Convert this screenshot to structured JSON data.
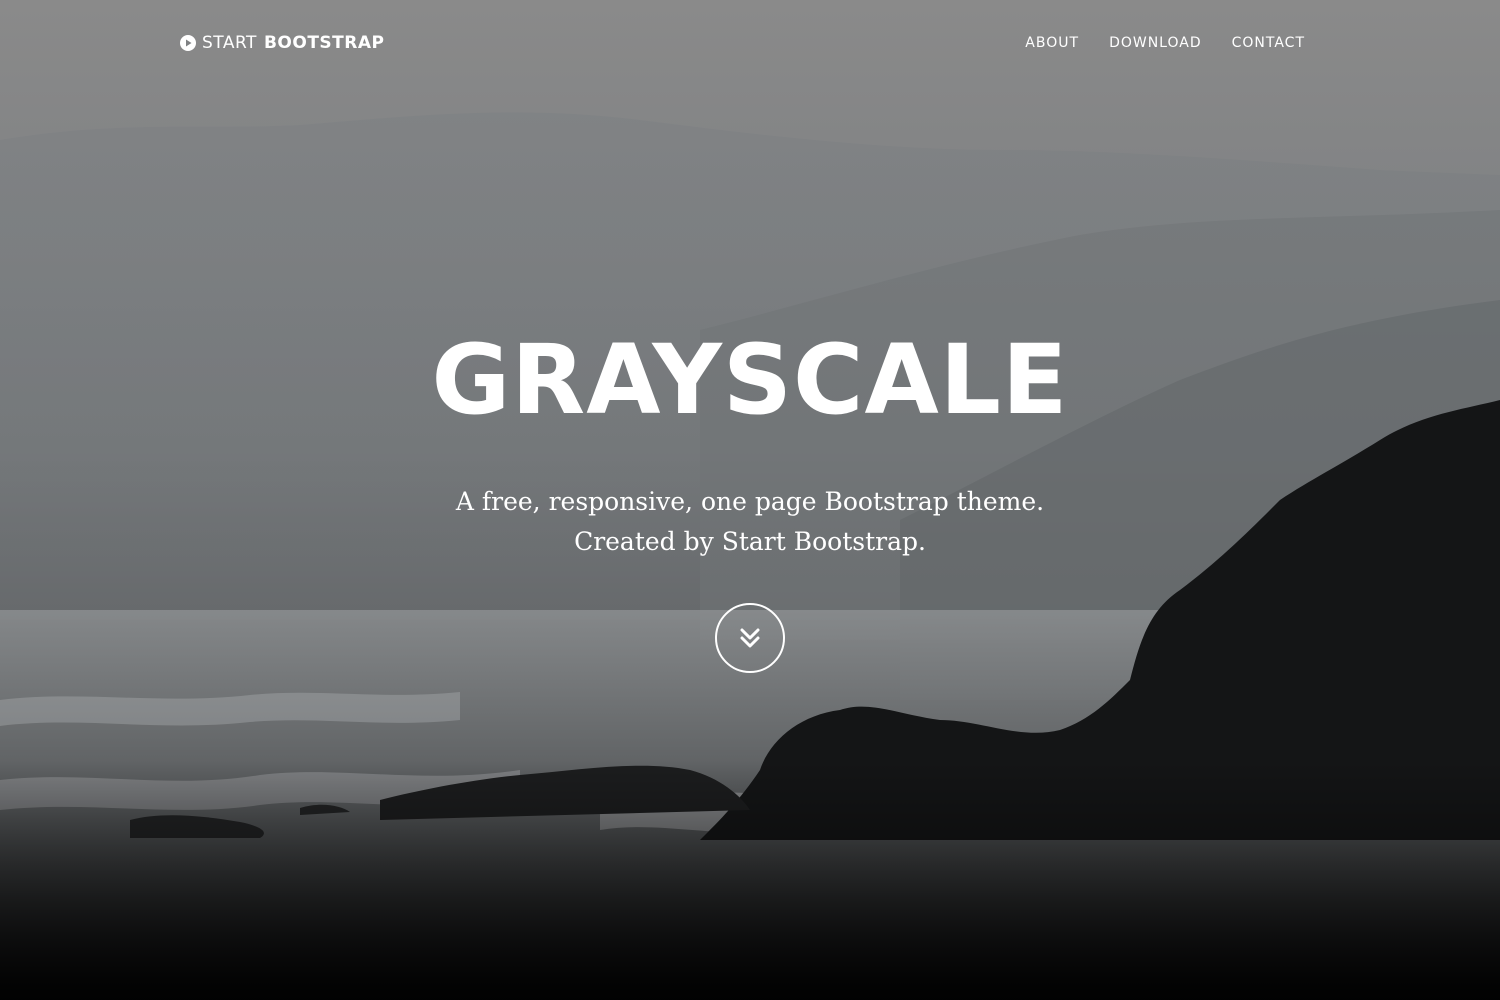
{
  "navbar": {
    "brand_prefix": "START",
    "brand_bold": "BOOTSTRAP",
    "links": [
      {
        "label": "ABOUT"
      },
      {
        "label": "DOWNLOAD"
      },
      {
        "label": "CONTACT"
      }
    ]
  },
  "masthead": {
    "heading": "GRAYSCALE",
    "intro_line1": "A free, responsive, one page Bootstrap theme.",
    "intro_line2": "Created by Start Bootstrap."
  },
  "icons": {
    "brand_icon": "play-circle-icon",
    "scroll_icon": "double-chevron-down-icon"
  },
  "colors": {
    "text": "#ffffff",
    "background_top": "#8a8a8a",
    "background_bottom": "#0b0b0b"
  }
}
